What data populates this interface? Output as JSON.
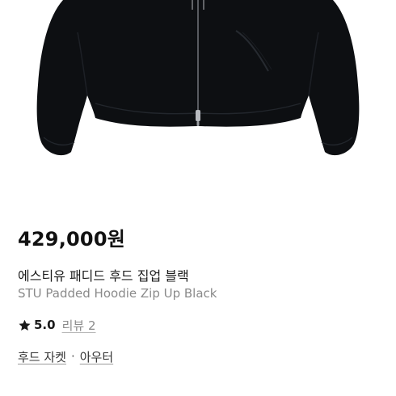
{
  "product": {
    "image_name": "black-padded-hoodie-zip-up-photo",
    "price": "429,000원",
    "name_ko": "에스티유 패디드 후드 집업 블랙",
    "name_en": "STU Padded Hoodie Zip Up Black",
    "rating": "5.0",
    "reviews_label": "리뷰 2",
    "categories": [
      "후드 자켓",
      "아우터"
    ],
    "category_separator": "·"
  },
  "colors": {
    "garment": "#0d0f12",
    "price_text": "#111111",
    "secondary_text": "#8a8a8a",
    "star": "#1a1a1a"
  },
  "icons": {
    "rating_star": "star-icon"
  }
}
